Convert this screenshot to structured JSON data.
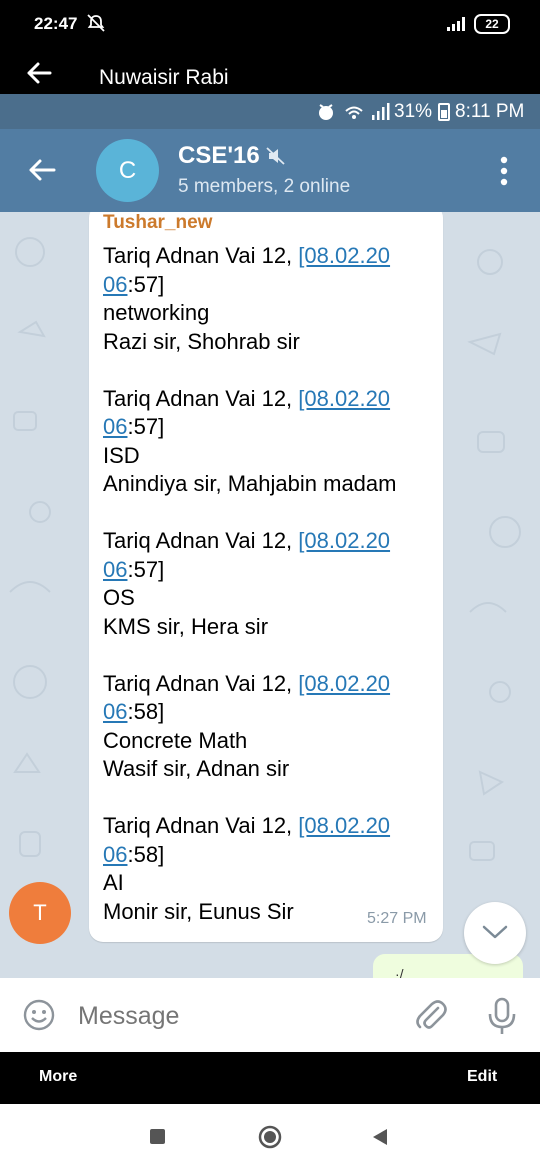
{
  "status_bar": {
    "time": "22:47",
    "battery_level": "22",
    "icons": [
      "do-not-disturb-icon",
      "signal-icon",
      "battery-icon"
    ]
  },
  "viewer": {
    "contact_name": "Nuwaisir Rabi",
    "more_label": "More",
    "edit_label": "Edit"
  },
  "inner_status": {
    "battery_percent": "31%",
    "time": "8:11 PM",
    "icons": [
      "alarm-icon",
      "wifi-icon",
      "signal-icon",
      "battery-icon"
    ]
  },
  "chat_header": {
    "avatar_letter": "C",
    "title": "CSE'16",
    "subtitle": "5 members, 2 online",
    "colors": {
      "header": "#527da3",
      "avatar": "#5ab4d8"
    }
  },
  "message": {
    "sender": "Tushar_new",
    "sender_avatar_letter": "T",
    "time": "5:27 PM",
    "sender_color": "#cc7a2c",
    "link_color": "#2678b6",
    "entries": [
      {
        "author": "Tariq Adnan Vai 12, ",
        "link_a": "[08.02.20",
        "link_b": "06",
        "rest": ":57]",
        "course": "networking",
        "teachers": "Razi sir, Shohrab sir"
      },
      {
        "author": "Tariq Adnan Vai 12, ",
        "link_a": "[08.02.20",
        "link_b": "06",
        "rest": ":57]",
        "course": "ISD",
        "teachers": "Anindiya sir, Mahjabin madam"
      },
      {
        "author": "Tariq Adnan Vai 12, ",
        "link_a": "[08.02.20",
        "link_b": "06",
        "rest": ":57]",
        "course": "OS",
        "teachers": "KMS sir, Hera sir"
      },
      {
        "author": "Tariq Adnan Vai 12, ",
        "link_a": "[08.02.20",
        "link_b": "06",
        "rest": ":58]",
        "course": "Concrete Math",
        "teachers": "Wasif sir, Adnan sir"
      },
      {
        "author": "Tariq Adnan Vai 12, ",
        "link_a": "[08.02.20",
        "link_b": "06",
        "rest": ":58]",
        "course": "AI",
        "teachers": "Monir sir, Eunus Sir"
      }
    ]
  },
  "composer": {
    "placeholder": "Message"
  }
}
